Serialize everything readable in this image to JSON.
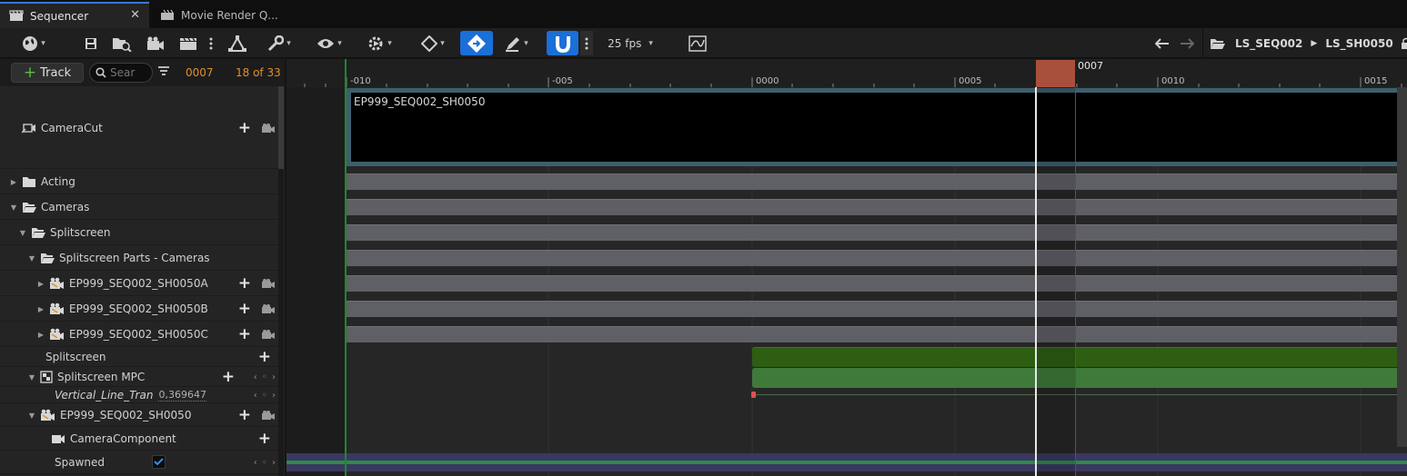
{
  "tabs": [
    {
      "label": "Sequencer",
      "active": true
    },
    {
      "label": "Movie Render Q..."
    }
  ],
  "toolbar": {
    "fps_label": "25 fps"
  },
  "breadcrumb": [
    "LS_SEQ002",
    "LS_SH0050"
  ],
  "filter": {
    "add_track_label": "Track",
    "search_placeholder": "Sear",
    "current_frame": "0007",
    "count_label": "18 of 33"
  },
  "outliner": {
    "camera_cut": "CameraCut",
    "acting": "Acting",
    "cameras": "Cameras",
    "splitscreen_folder": "Splitscreen",
    "splitscreen_parts": "Splitscreen Parts - Cameras",
    "cam_a": "EP999_SEQ002_SH0050A",
    "cam_b": "EP999_SEQ002_SH0050B",
    "cam_c": "EP999_SEQ002_SH0050C",
    "splitscreen_track": "Splitscreen",
    "splitscreen_mpc": "Splitscreen MPC",
    "vertical_line": "Vertical_Line_Tran",
    "vertical_line_value": "0,369647",
    "shot_camera": "EP999_SEQ002_SH0050",
    "camera_component": "CameraComponent",
    "spawned": "Spawned",
    "spawned_checked": true
  },
  "ruler": {
    "labels": [
      "-010",
      "-005",
      "0000",
      "0005",
      "0010",
      "0015"
    ],
    "playhead_label": "0007"
  },
  "timeline": {
    "cut_section_label": "EP999_SEQ002_SH0050"
  },
  "colors": {
    "accent_blue": "#1b6fd8",
    "playhead": "#a9503c",
    "frame_orange": "#e0902c",
    "green_section": "#2d5e12",
    "mpc_green": "#3f7a3a"
  }
}
